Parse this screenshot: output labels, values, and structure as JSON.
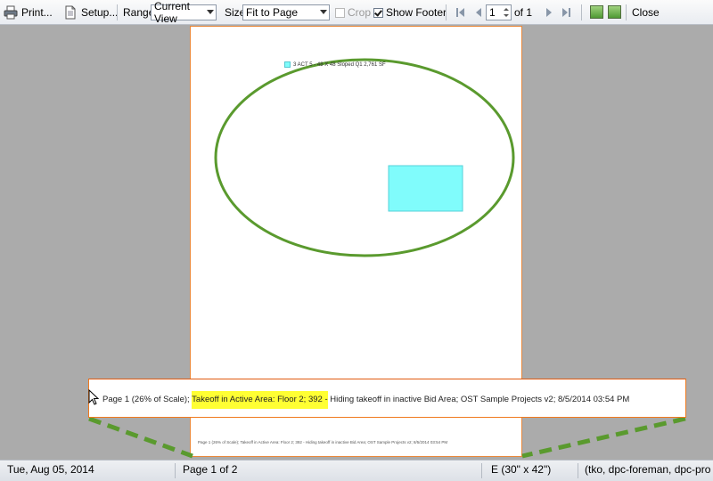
{
  "toolbar": {
    "print_label": "Print...",
    "setup_label": "Setup...",
    "range_label": "Range",
    "range_value": "Current View",
    "size_label": "Size",
    "size_value": "Fit to Page",
    "crop_label": "Crop",
    "crop_checked": false,
    "show_footer_label": "Show Footer",
    "show_footer_checked": true,
    "page_input_value": "1",
    "page_of_label": "of 1",
    "close_label": "Close"
  },
  "preview": {
    "legend_text": "3 ACT 5 - 48 X 48 Sloped Q1 2,761 SF",
    "tiny_footer_text": "Page 1 (26% of Scale); Takeoff in Active Area: Floor 2; 392 - Hiding takeoff in inactive Bid Area; OST Sample Projects v2; 8/5/2014 03:54 PM",
    "ellipse_color": "#5a9a2e",
    "area_fill_color": "#80fcfc",
    "page_border_color": "#e9883a"
  },
  "zoom_callout": {
    "prefix": "Page 1 (26% of Scale);",
    "highlight": "Takeoff in Active Area: Floor 2; 392 -",
    "suffix": "Hiding takeoff in inactive Bid Area; OST Sample Projects v2; 8/5/2014 03:54 PM",
    "highlight_color": "#ffff33",
    "dash_color": "#5a9a2e"
  },
  "status": {
    "date": "Tue, Aug 05, 2014",
    "page": "Page 1 of 2",
    "paper_size": "E (30\" x 42\")",
    "user": "(tko, dpc-foreman, dpc-pro"
  }
}
